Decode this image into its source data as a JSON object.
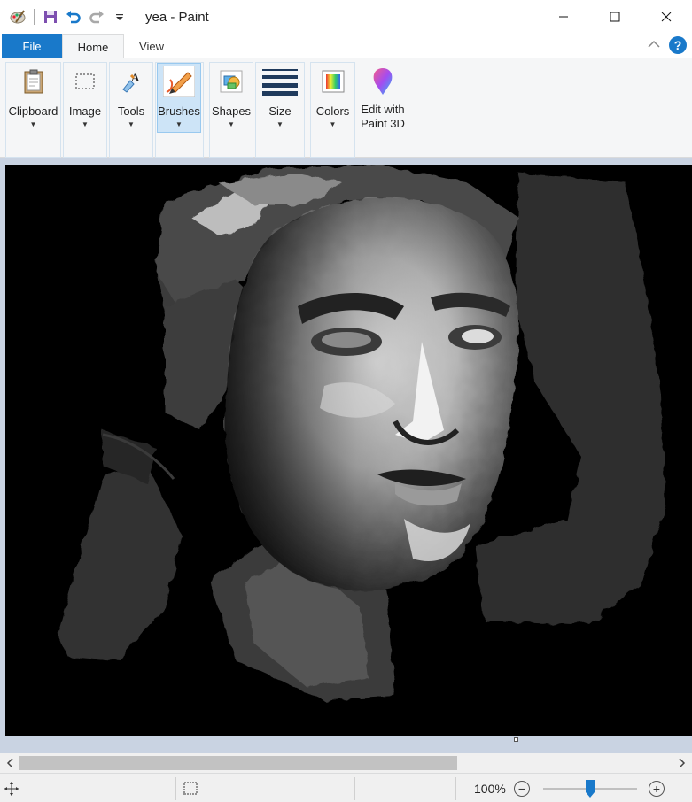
{
  "window": {
    "title": "yea - Paint"
  },
  "quick_access": {
    "icons": [
      "paint-app-icon",
      "save-icon",
      "undo-icon",
      "redo-icon",
      "customize-icon"
    ]
  },
  "tabs": {
    "file": "File",
    "home": "Home",
    "view": "View",
    "help": "?"
  },
  "ribbon": {
    "clipboard": "Clipboard",
    "image": "Image",
    "tools": "Tools",
    "brushes": "Brushes",
    "shapes": "Shapes",
    "size": "Size",
    "colors": "Colors",
    "edit3d_line1": "Edit with",
    "edit3d_line2": "Paint 3D"
  },
  "status": {
    "zoom": "100%",
    "zoom_level": 0.5
  },
  "colors": {
    "accent": "#1979ca",
    "selected": "#cde4f7",
    "workspace": "#c9d3e2",
    "slider_thumb": "#1979ca"
  }
}
